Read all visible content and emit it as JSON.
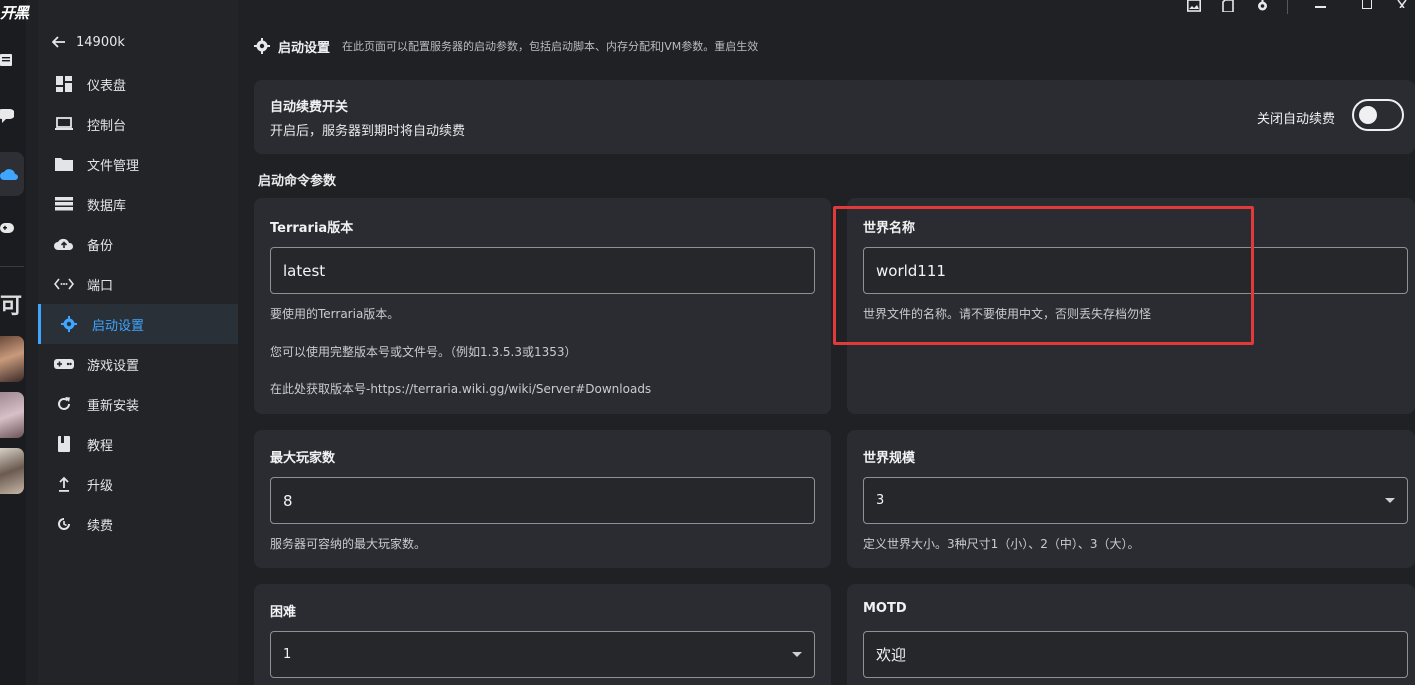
{
  "rail": {
    "logo_text": "开黑",
    "char_text": "可"
  },
  "sidenav": {
    "back_label": "14900k",
    "items": [
      {
        "label": "仪表盘",
        "icon": "dashboard-icon"
      },
      {
        "label": "控制台",
        "icon": "laptop-icon"
      },
      {
        "label": "文件管理",
        "icon": "folder-icon"
      },
      {
        "label": "数据库",
        "icon": "database-icon"
      },
      {
        "label": "备份",
        "icon": "cloud-upload-icon"
      },
      {
        "label": "端口",
        "icon": "port-icon"
      },
      {
        "label": "启动设置",
        "icon": "gear-icon",
        "active": true
      },
      {
        "label": "游戏设置",
        "icon": "gamepad-icon"
      },
      {
        "label": "重新安装",
        "icon": "refresh-icon"
      },
      {
        "label": "教程",
        "icon": "book-icon"
      },
      {
        "label": "升级",
        "icon": "upload-icon"
      },
      {
        "label": "续费",
        "icon": "renew-icon"
      }
    ]
  },
  "header": {
    "title": "启动设置",
    "description": "在此页面可以配置服务器的启动参数，包括启动脚本、内存分配和JVM参数。重启生效"
  },
  "autorenew": {
    "title": "自动续费开关",
    "subtitle": "开启后，服务器到期时将自动续费",
    "toggle_label": "关闭自动续费",
    "enabled": false
  },
  "section_title": "启动命令参数",
  "terraria_version": {
    "title": "Terraria版本",
    "value": "latest",
    "help": [
      "要使用的Terraria版本。",
      "您可以使用完整版本号或文件号。（例如1.3.5.3或1353）",
      "在此处获取版本号-https://terraria.wiki.gg/wiki/Server#Downloads"
    ]
  },
  "world_name": {
    "title": "世界名称",
    "value": "world111",
    "help": "世界文件的名称。请不要使用中文，否则丢失存档勿怪"
  },
  "max_players": {
    "title": "最大玩家数",
    "value": "8",
    "help": "服务器可容纳的最大玩家数。"
  },
  "world_size": {
    "title": "世界规模",
    "value": "3",
    "help": "定义世界大小。3种尺寸1（小）、2（中）、3（大）。"
  },
  "difficulty": {
    "title": "困难",
    "value": "1"
  },
  "motd": {
    "title": "MOTD",
    "value": "欢迎"
  },
  "colors": {
    "accent": "#3ea6ff",
    "highlight": "#e03a3a",
    "background": "#202124",
    "card": "#2b2c31"
  }
}
